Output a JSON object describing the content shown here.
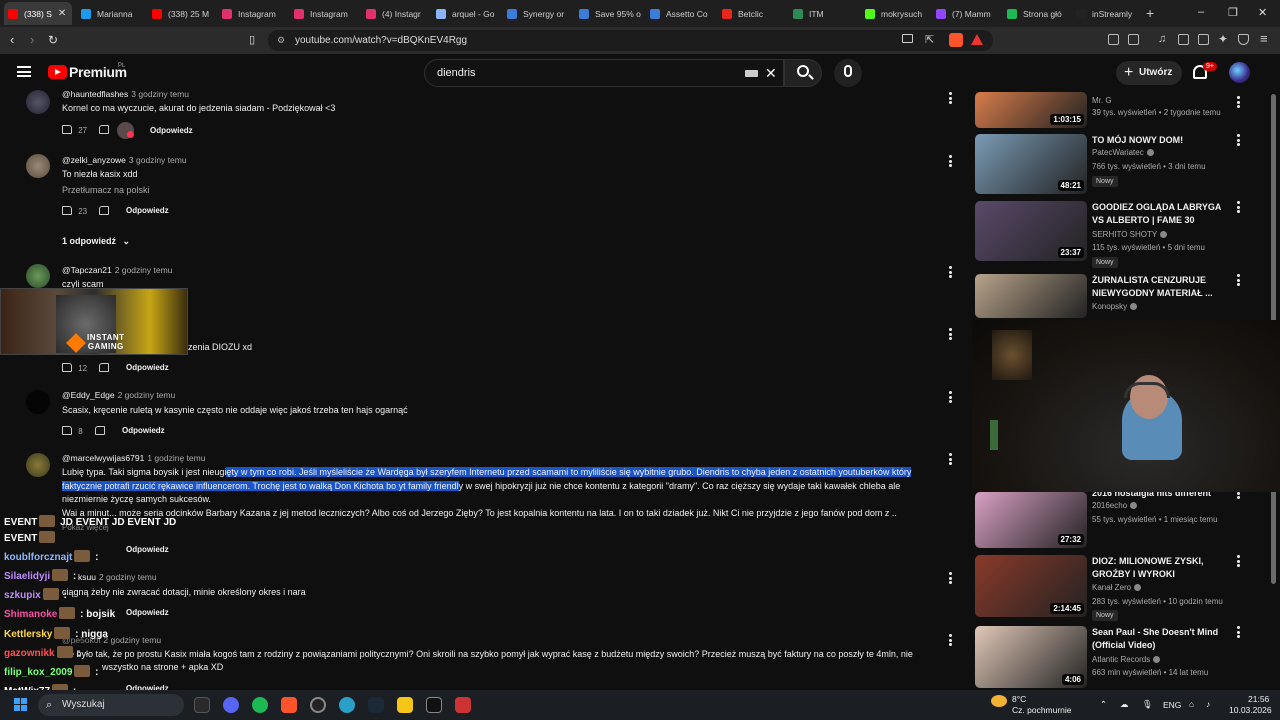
{
  "browser": {
    "tabs": [
      {
        "label": "(338) S",
        "color": "#ff0000",
        "active": true
      },
      {
        "label": "Marianna",
        "color": "#1d9bf0"
      },
      {
        "label": "(338) 25 M",
        "color": "#ff0000"
      },
      {
        "label": "Instagram",
        "color": "#e1306c"
      },
      {
        "label": "Instagram",
        "color": "#e1306c"
      },
      {
        "label": "(4) Instagr",
        "color": "#e1306c"
      },
      {
        "label": "arquel - Go",
        "color": "#8ab4f8"
      },
      {
        "label": "Synergy or",
        "color": "#3c7bd6"
      },
      {
        "label": "Save 95% o",
        "color": "#3c7bd6"
      },
      {
        "label": "Assetto Co",
        "color": "#3c7bd6"
      },
      {
        "label": "Betclic",
        "color": "#e8261b"
      },
      {
        "label": "ITM",
        "color": "#2e8b57"
      },
      {
        "label": "mokrysuch",
        "color": "#53fc18"
      },
      {
        "label": "(7) Mamm",
        "color": "#9146ff"
      },
      {
        "label": "Strona głó",
        "color": "#1db954"
      },
      {
        "label": "inStreamly",
        "color": "#222222"
      }
    ],
    "url": "youtube.com/watch?v=dBQKnEV4Rgg"
  },
  "yt": {
    "brand": "Premium",
    "brand_country": "PL",
    "search_value": "diendris",
    "create_label": "Utwórz",
    "notif_count": "9+"
  },
  "comments": [
    {
      "user": "@hauntedflashes",
      "time": "3 godziny temu",
      "text": "Kornel co ma wyczucie, akurat do jedzenia siadam - Podziękował <3",
      "likes": "27",
      "reply": "Odpowiedz"
    },
    {
      "user": "@zelki_anyzowe",
      "time": "3 godziny temu",
      "text": "To niezła kasix xdd",
      "translate": "Przetłumacz na polski",
      "likes": "23",
      "reply": "Odpowiedz",
      "replies_toggle": "1 odpowiedź"
    },
    {
      "user": "@Tapczan21",
      "time": "2 godziny temu",
      "text": "czyli scam"
    },
    {
      "text_tail": "zenia DIOZU xd",
      "likes": "12",
      "reply": "Odpowiedz"
    },
    {
      "user": "@Eddy_Edge",
      "time": "2 godziny temu",
      "text": "Scasix, kręcenie ruletą w kasynie często nie oddaje więc jakoś trzeba ten hajs ogarnąć",
      "likes": "8",
      "reply": "Odpowiedz"
    },
    {
      "user": "@marcelwywijas6791",
      "time": "1 godzinę temu",
      "line1_a": "Lubię typa. Taki sigma boysik i jest nieugi",
      "line1_b": "ęty w tym co robi. Jeśli myśleliście że Wardęga był szeryfem Internetu przed scamami to myliliście się wybitnie grubo. Diendris to chyba jeden z ostatnich youtuberków który",
      "line2_a": "faktycznie potrafi rzucić rękawice influencerom. Trochę jest to walką Don Kichota bo yt family friendl",
      "line2_b": "y w swej hipokryzji już nie chce kontentu z kategorii \"dramy\". Co raz cięższy się wydaje taki kawałek chleba ale",
      "line3": "niezmiernie życzę samych sukcesów.",
      "line4": "Wai a minut... może seria odcinków Barbary Kazana z jej metod leczniczych? Albo coś od Jerzego Zięby? To jest kopalnia kontentu na lata. I on to taki dziadek już. Nikt Ci nie przyjdzie z jego fanów pod dom z ..",
      "more": "Pokaż więcej",
      "reply": "Odpowiedz"
    },
    {
      "user": "ksuu",
      "time": "2 godziny temu",
      "text": "ciągną żeby nie zwracać dotacji, minie określony okres i nara",
      "reply": "Odpowiedz"
    },
    {
      "user": "@pe5okol",
      "time": "2 godziny temu",
      "text": "nie było tak, że po prostu Kasix miała kogoś tam z rodziny z powiązaniami politycznymi? Oni skroili na szybko pomył jak wyprać kasę z budżetu między swoich? Przecież muszą być faktury na co poszły te 4mln, nie",
      "text2": "wszystko na strone + apka XD",
      "reply": "Odpowiedz"
    }
  ],
  "sidebar": [
    {
      "title": "",
      "channel": "Mr. G",
      "meta": "39 tys. wyświetleń • 2 tygodnie temu",
      "duration": "1:03:15",
      "thumb": "#d77c4a"
    },
    {
      "title": "TO MÓJ NOWY DOM!",
      "channel": "PatecWariatec",
      "meta": "766 tys. wyświetleń • 3 dni temu",
      "badge": "Nowy",
      "duration": "48:21",
      "thumb": "#7a9bb5"
    },
    {
      "title": "GOODIEZ OGLĄDA LABRYGA VS ALBERTO | FAME 30",
      "channel": "SERHITO SHOTY",
      "meta": "115 tys. wyświetleń • 5 dni temu",
      "badge": "Nowy",
      "duration": "23:37",
      "thumb": "#5a4a6a"
    },
    {
      "title": "ŻURNALISTA CENZURUJE NIEWYGODNY MATERIAŁ ...",
      "channel": "Konopsky",
      "meta": "",
      "duration": "",
      "thumb": "#b8a48a"
    },
    {
      "title": "2016 nostalgia hits different",
      "channel": "2016echo",
      "meta": "55 tys. wyświetleń • 1 miesiąc temu",
      "duration": "27:32",
      "thumb": "#d9a0c4"
    },
    {
      "title": "DIOZ: MILIONOWE ZYSKI, GROŹBY I WYROKI",
      "channel": "Kanał Zero",
      "meta": "283 tys. wyświetleń • 10 godzin temu",
      "badge": "Nowy",
      "duration": "2:14:45",
      "thumb": "#8a3a2a"
    },
    {
      "title": "Sean Paul - She Doesn't Mind (Official Video)",
      "channel": "Atlantic Records",
      "meta": "663 mln wyświetleń • 14 lat temu",
      "duration": "4:06",
      "thumb": "#e0c8b8"
    }
  ],
  "overlay": {
    "sponsor_line1": "INSTANT",
    "sponsor_line2": "GAMING",
    "chat": [
      {
        "user": "EVENT",
        "msg": "JD EVENT      JD EVENT      JD",
        "color": "#ffffff"
      },
      {
        "user": "EVENT",
        "msg": "",
        "color": "#ffffff"
      },
      {
        "user": "koublforcznajt",
        "msg": ":",
        "color": "#8fb8ff"
      },
      {
        "user": "Silaelidyji",
        "msg": ":",
        "color": "#c08cff"
      },
      {
        "user": "szkupix",
        "msg": ":",
        "color": "#c08cff"
      },
      {
        "user": "Shimanoke",
        "msg": ": bojsik",
        "color": "#ff4fa8"
      },
      {
        "user": "Kettlersky",
        "msg": ": nigga",
        "color": "#ffd94a"
      },
      {
        "user": "gazownikk",
        "msg": ":",
        "color": "#ff5050"
      },
      {
        "user": "filip_kox_2009",
        "msg": ":",
        "color": "#7dff7d"
      },
      {
        "user": "MatWix77",
        "msg": ":",
        "color": "#ffffff"
      }
    ]
  },
  "taskbar": {
    "search_placeholder": "Wyszukaj",
    "weather_temp": "8°C",
    "weather_desc": "Cz. pochmurnie",
    "lang": "ENG",
    "time": "21:56",
    "date": "10.03.2026"
  }
}
